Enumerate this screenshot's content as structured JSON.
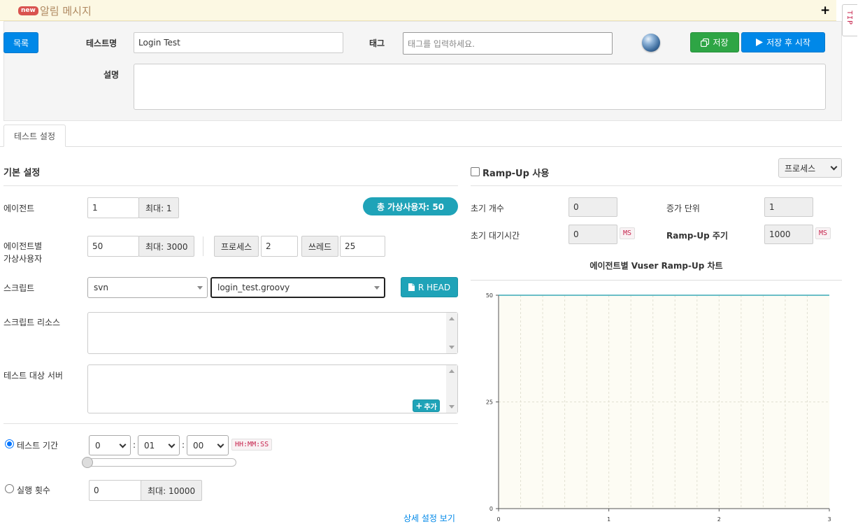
{
  "alert": {
    "badge": "new",
    "title": "알림 메시지",
    "tip": "TIP"
  },
  "header": {
    "list_button": "목록",
    "test_name_label": "테스트명",
    "test_name_value": "Login Test",
    "tag_label": "태그",
    "tag_placeholder": "태그를 입력하세요.",
    "save_button": "저장",
    "save_start_button": "저장 후 시작",
    "description_label": "설명",
    "description_value": ""
  },
  "tabs": [
    "테스트 설정"
  ],
  "basic": {
    "section_title": "기본 설정",
    "total_vusers": "총 가상사용자: 50",
    "agent_label": "에이전트",
    "agent_value": "1",
    "agent_max": "최대: 1",
    "vuser_label_1": "에이전트별",
    "vuser_label_2": "가상사용자",
    "vuser_value": "50",
    "vuser_max": "최대: 3000",
    "process_label": "프로세스",
    "process_value": "2",
    "thread_label": "쓰레드",
    "thread_value": "25",
    "script_label": "스크립트",
    "script_repo": "svn",
    "script_file": "login_test.groovy",
    "rhead_button": "R HEAD",
    "script_resource_label": "스크립트 리소스",
    "target_server_label": "테스트 대상 서버",
    "add_button": "추가",
    "duration_label": "테스트 기간",
    "duration_hours": "0",
    "duration_minutes": "01",
    "duration_seconds": "00",
    "duration_unit": "HH:MM:SS",
    "duration_selected": true,
    "run_count_label": "실행 횟수",
    "run_count_value": "0",
    "run_count_max": "최대: 10000",
    "detail_link": "상세 설정 보기"
  },
  "rampup": {
    "enable_label": "Ramp-Up 사용",
    "enabled": false,
    "type_select": "프로세스",
    "initial_count_label": "초기 개수",
    "initial_count_value": "0",
    "increment_label": "증가 단위",
    "increment_value": "1",
    "initial_sleep_label": "초기 대기시간",
    "initial_sleep_value": "0",
    "initial_sleep_unit": "MS",
    "interval_label": "Ramp-Up 주기",
    "interval_value": "1000",
    "interval_unit": "MS"
  },
  "chart_data": {
    "type": "line",
    "title": "에이전트별 Vuser Ramp-Up 차트",
    "x": [
      0,
      3
    ],
    "y": [
      50,
      50
    ],
    "xticks": [
      "0",
      "1",
      "2",
      "3"
    ],
    "yticks": [
      "0",
      "25",
      "50"
    ],
    "xlim": [
      0,
      3
    ],
    "ylim": [
      0,
      50
    ],
    "grid": true,
    "line_color": "#3aa9b5",
    "background": "#fdfcf4"
  }
}
